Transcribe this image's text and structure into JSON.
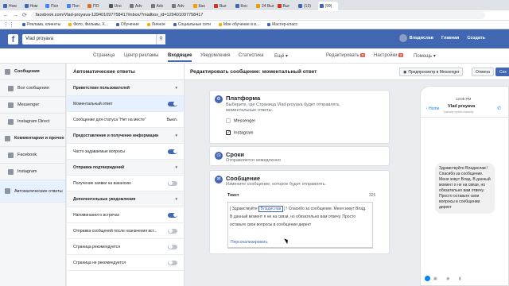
{
  "browser": {
    "tabs": [
      "Ном",
      "Ном",
      "Пол",
      "Пол",
      "ПО",
      "Uno",
      "Adv",
      "Adv",
      "Adv",
      "Кан",
      "Выг",
      "Кон",
      "24 Выг",
      "Выг",
      "(13)",
      "(99)"
    ],
    "url": "facebook.com/Vlad-proyava-129401097758417/inbox/?mailbox_id=129401097758417",
    "bookmarks": [
      "Реклама, клиенты",
      "Фото, Фильмы, Х...",
      "Обучение",
      "Личное",
      "Социальные сети",
      "Мое обучение в в...",
      "Мастер-класс"
    ]
  },
  "fb": {
    "search": "Vlad proyava",
    "user": "Владислав",
    "home": "Главная",
    "create": "Создать"
  },
  "pagenav": {
    "items": [
      "Страница",
      "Центр рекламы",
      "Входящие",
      "Уведомления",
      "Статистика",
      "Ещё ▾"
    ],
    "edit": "Редактировать",
    "edit_badge": "5",
    "settings": "Настройки",
    "settings_badge": "2",
    "help": "Помощь ▾"
  },
  "leftnav": [
    {
      "label": "Сообщения",
      "icon": "chat-icon"
    },
    {
      "label": "Все сообщения",
      "icon": "inbox-icon"
    },
    {
      "label": "Messenger",
      "icon": "messenger-icon"
    },
    {
      "label": "Instagram Direct",
      "icon": "instagram-icon"
    },
    {
      "label": "Комментарии и прочее",
      "icon": "comment-icon"
    },
    {
      "label": "Facebook",
      "icon": "facebook-icon"
    },
    {
      "label": "Instagram",
      "icon": "instagram-icon"
    },
    {
      "label": "Автоматические ответы",
      "icon": "robot-icon"
    }
  ],
  "auto": {
    "title": "Автоматические ответы",
    "rows": [
      {
        "label": "Приветствие пользователей",
        "type": "section"
      },
      {
        "label": "Моментальный ответ",
        "type": "toggle",
        "on": true,
        "active": true
      },
      {
        "label": "Сообщение для статуса \"Нет на месте\"",
        "type": "value",
        "value": "Выкл."
      },
      {
        "label": "Предоставление и получение информации",
        "type": "section"
      },
      {
        "label": "Часто задаваемые вопросы",
        "type": "toggle",
        "on": true
      },
      {
        "label": "Отправка подтверждений",
        "type": "section"
      },
      {
        "label": "Получение заявки на вакансию",
        "type": "toggle",
        "on": false
      },
      {
        "label": "Дополнительные уведомления",
        "type": "section"
      },
      {
        "label": "Напоминания о встречах",
        "type": "toggle",
        "on": true
      },
      {
        "label": "Отправка сообщений после назначения вст...",
        "type": "toggle",
        "on": false
      },
      {
        "label": "Страница рекомендуется",
        "type": "toggle",
        "on": false
      },
      {
        "label": "Страница не рекомендуется",
        "type": "toggle",
        "on": false
      }
    ]
  },
  "editor": {
    "title": "Редактировать сообщение: моментальный ответ",
    "preview_btn": "Предпросмотр в Messenger",
    "cancel_btn": "Отмена",
    "save_btn": "Сох",
    "platform": {
      "title": "Платформа",
      "desc": "Выберите, где Страница Vlad proyava будет отправлять моментальные ответы.",
      "options": [
        {
          "label": "Messenger",
          "checked": false
        },
        {
          "label": "Instagram",
          "checked": true
        }
      ]
    },
    "timing": {
      "title": "Сроки",
      "desc": "Отправляется немедленно"
    },
    "message": {
      "title": "Сообщение",
      "desc": "Измените сообщение, которое будет отправлять.",
      "text_label": "Текст",
      "counter": "326",
      "pre": "[ Здравствуйте",
      "chip": "Владислав",
      "line1": "] ! Спасибо за сообщение. Меня зовут Влад.",
      "line2": "В данный момент я не на связи, но обязательно вам отвечу. Просто",
      "line3": "оставьте свои вопросы в сообщении директ",
      "personalize": "Персонализировать"
    }
  },
  "preview": {
    "time": "12:05 PM",
    "back": "Home",
    "page": "Vlad proyava",
    "status": "Typically replies instantly",
    "bubble": "Здравствуйте Владислав ! Спасибо за сообщение. Меня зовут Влад. В данный момент я не на связи, но обязательно вам отвечу. Просто оставьте свои вопросы в сообщении директ"
  }
}
